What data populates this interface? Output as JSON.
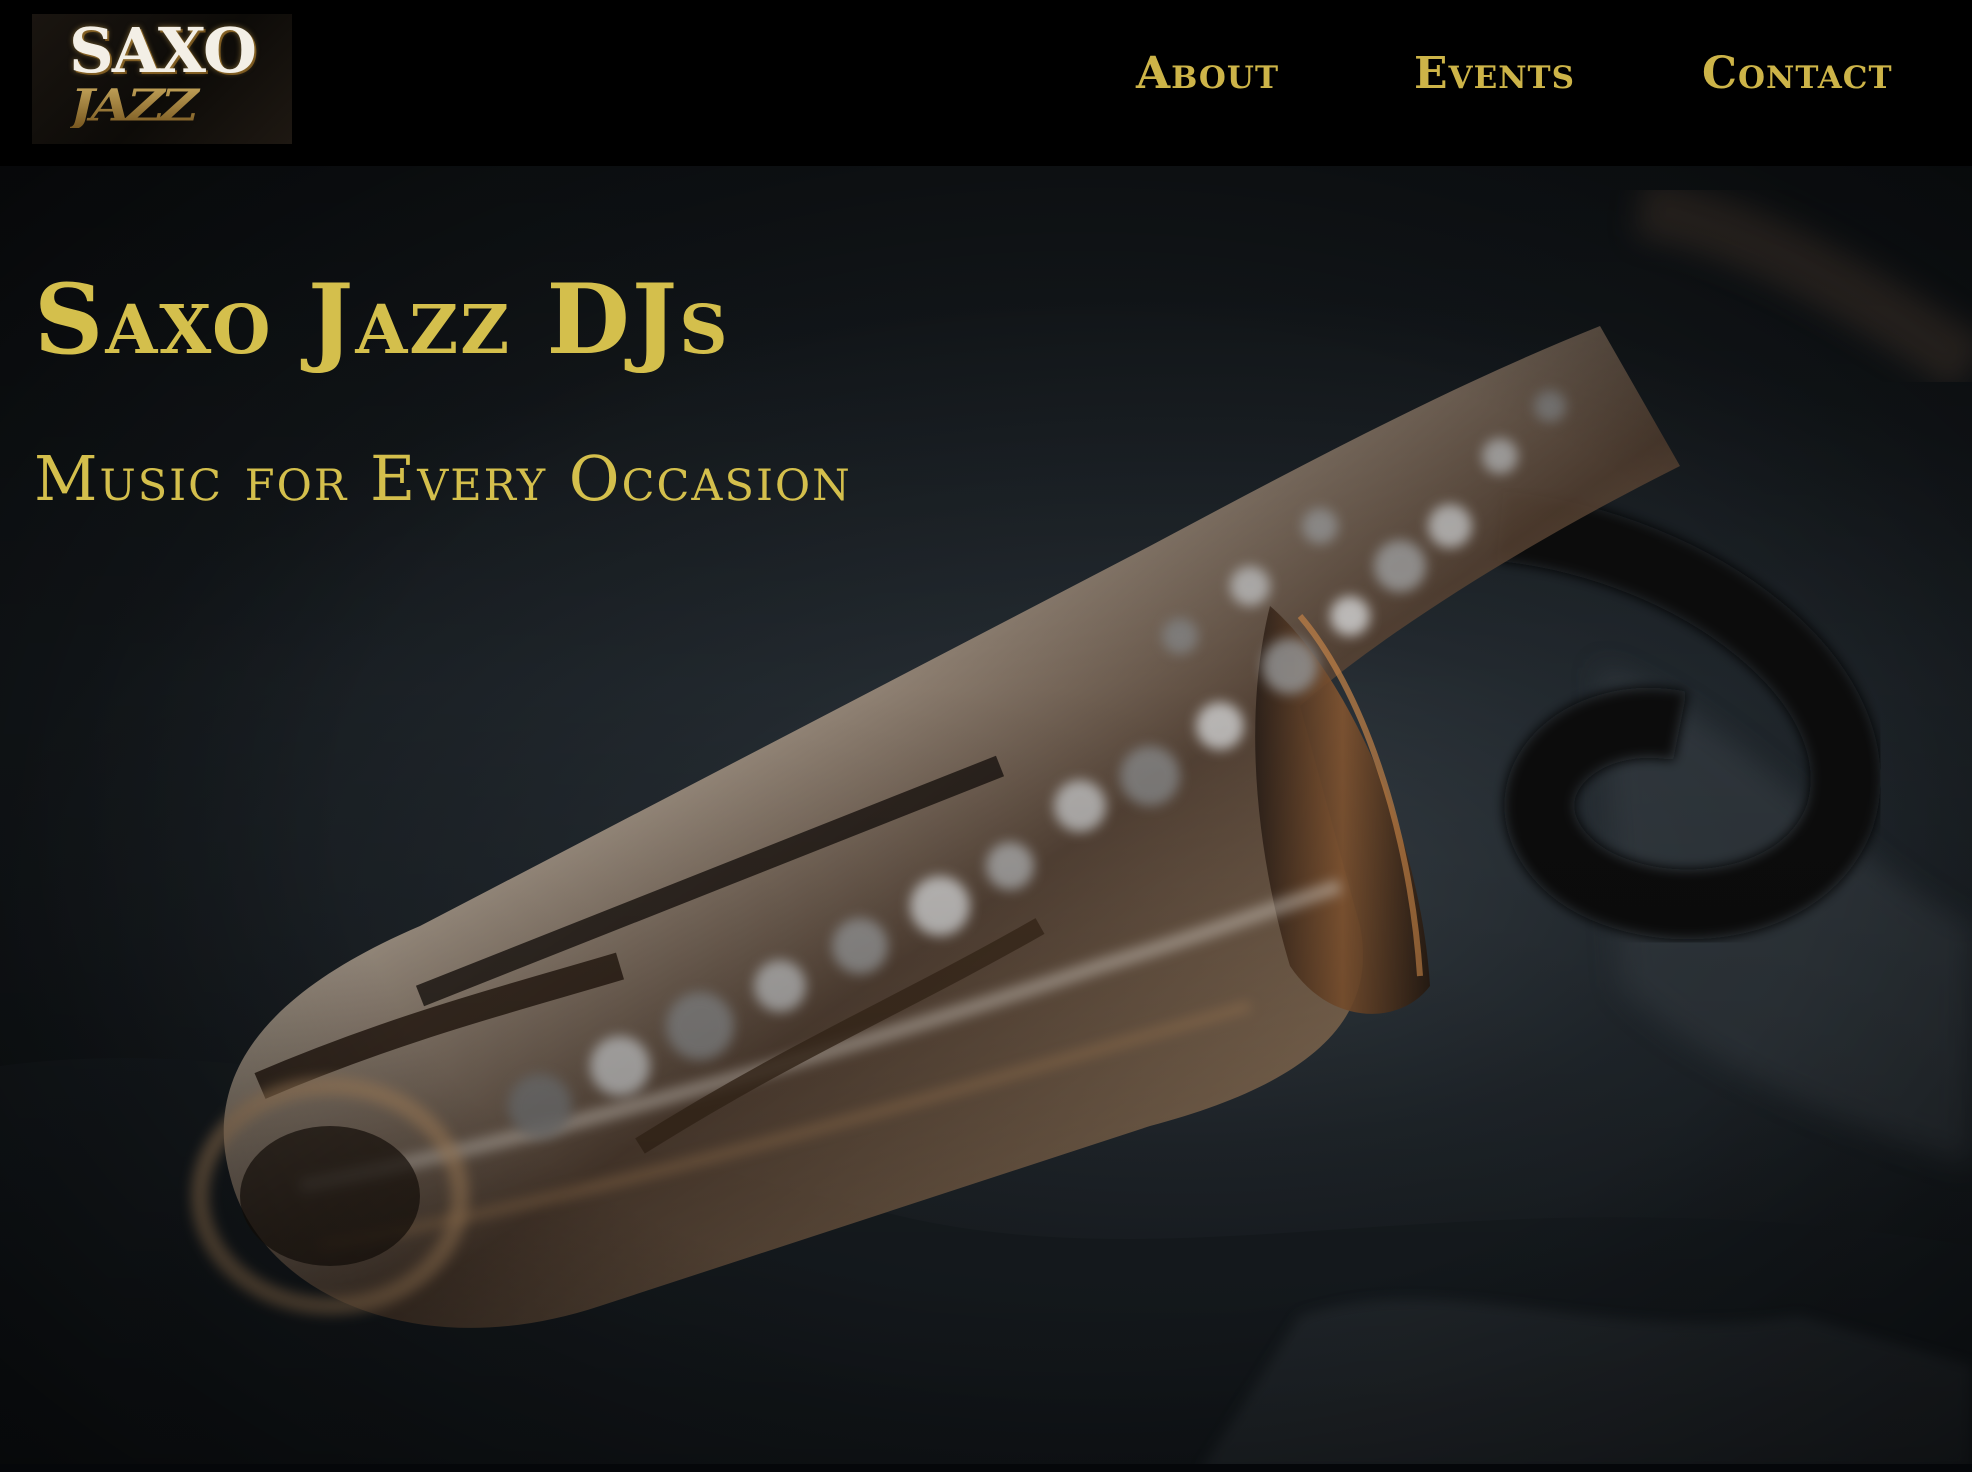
{
  "logo": {
    "line1": "SAXO",
    "line2": "JAZZ"
  },
  "nav": {
    "items": [
      {
        "label": "About"
      },
      {
        "label": "Events"
      },
      {
        "label": "Contact"
      }
    ]
  },
  "hero": {
    "title": "Saxo Jazz DJs",
    "subtitle": "Music for Every Occasion",
    "background_image": "saxophone-photo"
  },
  "colors": {
    "accent_gold": "#cdb448",
    "header_background": "#000000",
    "hero_background": "#1e252a"
  }
}
